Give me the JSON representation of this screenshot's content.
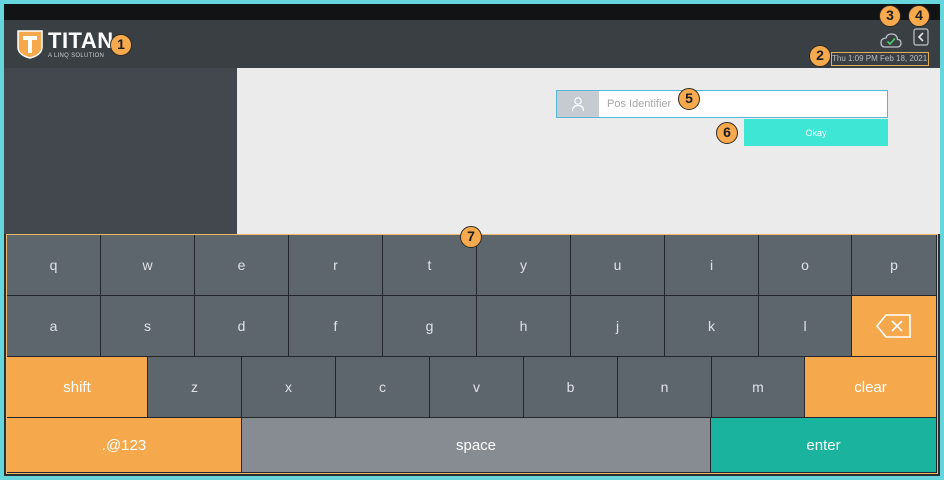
{
  "header": {
    "logo_title": "TITAN",
    "logo_subtitle": "A LINQ SOLUTION",
    "datetime": "Thu 1:09 PM Feb 18, 2021"
  },
  "login": {
    "pos_placeholder": "Pos Identifier",
    "okay_label": "Okay"
  },
  "keyboard": {
    "row1": [
      "q",
      "w",
      "e",
      "r",
      "t",
      "y",
      "u",
      "i",
      "o",
      "p"
    ],
    "row2": [
      "a",
      "s",
      "d",
      "f",
      "g",
      "h",
      "j",
      "k",
      "l"
    ],
    "shift_label": "shift",
    "row3": [
      "z",
      "x",
      "c",
      "v",
      "b",
      "n",
      "m"
    ],
    "clear_label": "clear",
    "symbols_label": ".@123",
    "space_label": "space",
    "enter_label": "enter"
  },
  "callouts": [
    "1",
    "2",
    "3",
    "4",
    "5",
    "6",
    "7"
  ],
  "colors": {
    "accent_orange": "#f6a84c",
    "okay_teal": "#3ee6d6",
    "enter_teal": "#1ab39d",
    "key_gray": "#5d656d",
    "header_dark": "#3a3f44"
  },
  "icons": {
    "logo": "titan-shield-icon",
    "sync": "cloud-check-icon",
    "back": "chevron-left-icon",
    "user": "user-icon",
    "backspace": "backspace-icon"
  }
}
